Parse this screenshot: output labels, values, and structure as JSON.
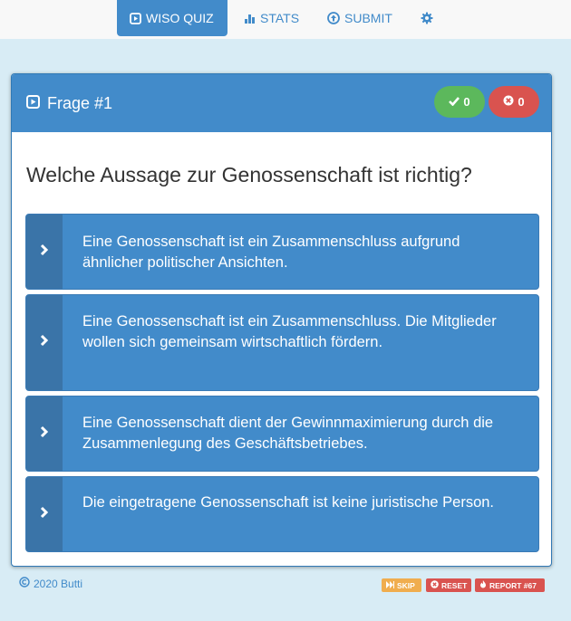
{
  "nav": {
    "quiz_label": "WISO QUIZ",
    "stats_label": "STATS",
    "submit_label": "SUBMIT"
  },
  "question": {
    "header": "Frage #1",
    "correct_count": "0",
    "wrong_count": "0",
    "text": "Welche Aussage zur Genossenschaft ist richtig?"
  },
  "answers": [
    "Eine Genossenschaft ist ein Zusammenschluss aufgrund ähnlicher politischer Ansichten.",
    "Eine Genossenschaft ist ein Zusammenschluss. Die Mitglieder wollen sich gemeinsam wirtschaftlich fördern.",
    "Eine Genossenschaft dient der Gewinnmaximierung durch die Zusammenlegung des Geschäftsbetriebes.",
    "Die eingetragene Genossenschaft ist keine juristische Person."
  ],
  "footer": {
    "copyright": "2020 Butti",
    "skip_label": "SKIP",
    "reset_label": "RESET",
    "report_label": "REPORT #67"
  },
  "colors": {
    "primary": "#428bca",
    "success": "#5cb85c",
    "danger": "#d9534f",
    "warning": "#f0ad4e",
    "background": "#d8ecf5"
  },
  "icons": {
    "quiz": "play-square-icon",
    "stats": "bar-chart-icon",
    "submit": "arrow-up-circle-icon",
    "settings": "gear-icon",
    "correct": "check-icon",
    "wrong": "times-circle-icon",
    "answer": "chevron-right-icon",
    "skip": "fast-forward-icon",
    "reset": "times-circle-icon",
    "report": "fire-icon",
    "copyright": "copyright-icon"
  }
}
